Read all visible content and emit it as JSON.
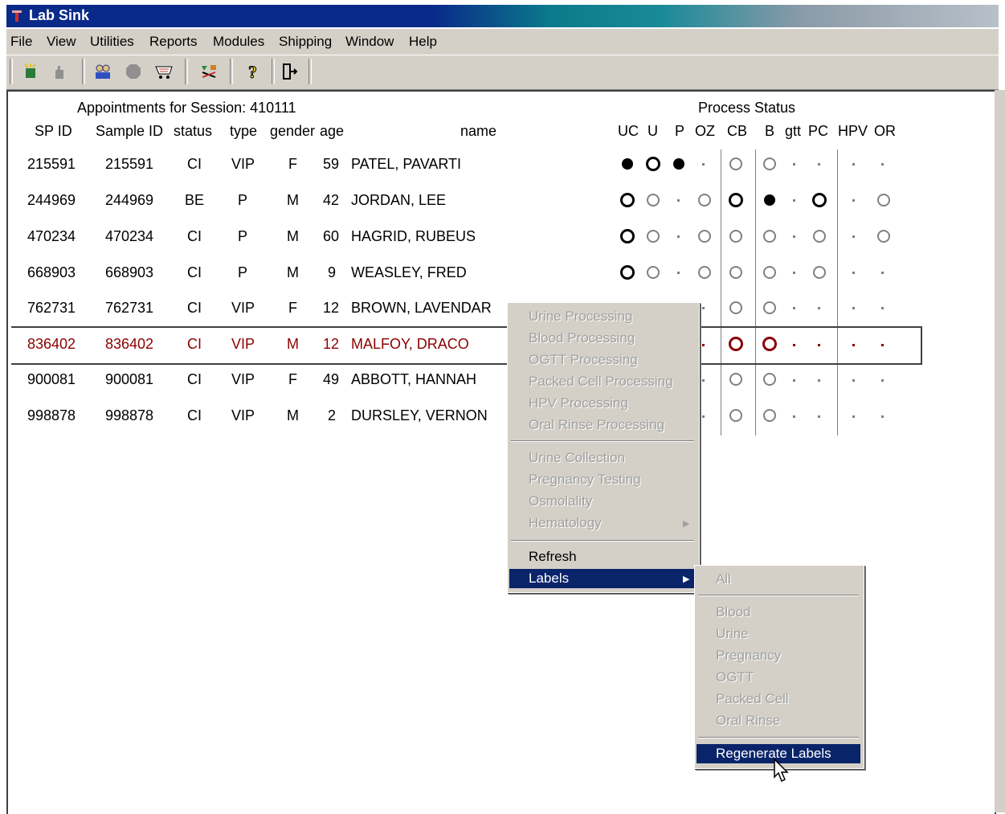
{
  "window": {
    "title": "Lab Sink"
  },
  "menubar": [
    "File",
    "View",
    "Utilities",
    "Reports",
    "Modules",
    "Shipping",
    "Window",
    "Help"
  ],
  "toolbar_icons": [
    "new-icon",
    "hand-icon",
    "people-icon",
    "stop-icon",
    "cart-icon",
    "chart-icon",
    "help-icon",
    "exit-icon"
  ],
  "header": {
    "session_title": "Appointments for Session: 410111",
    "process_status": "Process Status",
    "columns": [
      "SP ID",
      "Sample ID",
      "status",
      "type",
      "gender",
      "age",
      "name"
    ],
    "status_columns": [
      "UC",
      "U",
      "P",
      "OZ",
      "CB",
      "B",
      "gtt",
      "PC",
      "HPV",
      "OR"
    ]
  },
  "rows": [
    {
      "sp_id": "215591",
      "sample_id": "215591",
      "status": "CI",
      "type": "VIP",
      "gender": "F",
      "age": "59",
      "name": "PATEL, PAVARTI"
    },
    {
      "sp_id": "244969",
      "sample_id": "244969",
      "status": "BE",
      "type": "P",
      "gender": "M",
      "age": "42",
      "name": "JORDAN, LEE"
    },
    {
      "sp_id": "470234",
      "sample_id": "470234",
      "status": "CI",
      "type": "P",
      "gender": "M",
      "age": "60",
      "name": "HAGRID, RUBEUS"
    },
    {
      "sp_id": "668903",
      "sample_id": "668903",
      "status": "CI",
      "type": "P",
      "gender": "M",
      "age": "9",
      "name": "WEASLEY, FRED"
    },
    {
      "sp_id": "762731",
      "sample_id": "762731",
      "status": "CI",
      "type": "VIP",
      "gender": "F",
      "age": "12",
      "name": "BROWN, LAVENDAR"
    },
    {
      "sp_id": "836402",
      "sample_id": "836402",
      "status": "CI",
      "type": "VIP",
      "gender": "M",
      "age": "12",
      "name": "MALFOY, DRACO"
    },
    {
      "sp_id": "900081",
      "sample_id": "900081",
      "status": "CI",
      "type": "VIP",
      "gender": "F",
      "age": "49",
      "name": "ABBOTT, HANNAH"
    },
    {
      "sp_id": "998878",
      "sample_id": "998878",
      "status": "CI",
      "type": "VIP",
      "gender": "M",
      "age": "2",
      "name": "DURSLEY, VERNON"
    }
  ],
  "selected_row_sp_id": "836402",
  "context_menu": {
    "items": [
      "Urine Processing",
      "Blood Processing",
      "OGTT Processing",
      "Packed Cell Processing",
      "HPV Processing",
      "Oral Rinse Processing",
      "Urine Collection",
      "Pregnancy Testing",
      "Osmolality",
      "Hematology",
      "Refresh",
      "Labels"
    ],
    "highlighted": "Labels"
  },
  "labels_submenu": {
    "items": [
      "All",
      "Blood",
      "Urine",
      "Pregnancy",
      "OGTT",
      "Packed Cell",
      "Oral Rinse",
      "Regenerate Labels"
    ],
    "highlighted": "Regenerate Labels"
  },
  "colors": {
    "title_bar": "#0a2a8a",
    "menu_highlight": "#0a246a",
    "selected_row_text": "#8b0000",
    "chrome": "#d4d0c8"
  }
}
